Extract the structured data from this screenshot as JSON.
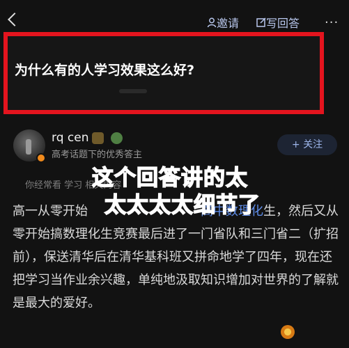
{
  "nav": {
    "invite_label": "邀请",
    "write_label": "写回答",
    "more_label": "···"
  },
  "question": {
    "title": "为什么有的人学习效果这么好?"
  },
  "author": {
    "name": "rq cen",
    "tag": "高考话题下的优秀答主",
    "follow_label": "+ 关注"
  },
  "related": "你经常看 学习 相关内容",
  "overlay": {
    "line1": "这个回答讲的太",
    "line2": "太太太太细节了"
  },
  "answer": {
    "part1": "高一从零开始",
    "link": "高中数理化",
    "part2": "生，然后又从零开始搞数理化生竞赛最后进了一门省队和三门省二（扩招前），保送清华后在清华基科班又拼命地学了四年，现在还把学习当作业余兴趣，单纯地汲取知识增加对世界的了解就是最大的爱好。"
  },
  "icons": [
    "back-icon",
    "invite-icon",
    "edit-icon",
    "more-icon",
    "level-badge-icon",
    "plus-badge-icon",
    "answerer-badge-icon",
    "watermark-logo-icon"
  ],
  "colors": {
    "highlight_border": "#e4141e",
    "accent": "#b9c8ee",
    "link": "#5e8ce8",
    "overlay_text": "#2f6bff"
  }
}
